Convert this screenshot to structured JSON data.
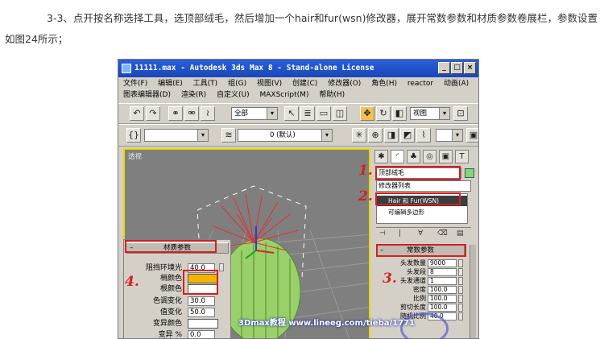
{
  "article": {
    "paragraph": "3-3、点开按名称选择工具，选顶部绒毛，然后增加一个hair和fur(wsn)修改器，展开常数参数和材质参数卷展栏，参数设置如图24所示；"
  },
  "window": {
    "title": "11111.max - Autodesk 3ds Max 8  - Stand-alone License",
    "controls": [
      "_",
      "□",
      "×"
    ]
  },
  "menu": {
    "row1": [
      "文件(F)",
      "编辑(E)",
      "工具(T)",
      "组(G)",
      "视图(V)",
      "创建(C)",
      "修改器(O)",
      "角色(H)",
      "reactor",
      "动画(A)"
    ],
    "row2": [
      "图表编辑器(D)",
      "渲染(R)",
      "自定义(U)",
      "MAXScript(M)",
      "帮助(H)"
    ]
  },
  "toolbar": {
    "selection_filter": "全部",
    "view_combo": "视图",
    "layer_combo": "0 (默认)"
  },
  "viewport": {
    "label": "透视"
  },
  "command_panel": {
    "object_name": "顶部绒毛",
    "modifier_list": "修改器列表",
    "stack": [
      "Hair 和 Fur(WSN)",
      "可编辑多边形"
    ],
    "rollout_title": "常数参数",
    "params": [
      {
        "label": "头发数量",
        "value": "9000"
      },
      {
        "label": "头发段",
        "value": "8"
      },
      {
        "label": "头发通道",
        "value": "1"
      },
      {
        "label": "密度",
        "value": "100.0"
      },
      {
        "label": "比例",
        "value": "100.0"
      },
      {
        "label": "剪切长度",
        "value": "100.0"
      },
      {
        "label": "随机比例",
        "value": "40.0"
      }
    ],
    "obj_color": "#7bd87b"
  },
  "material_panel": {
    "title": "材质参数",
    "rows": [
      {
        "label": "阻挡环境光",
        "value": "40.0",
        "kind": "num"
      },
      {
        "label": "梢颜色",
        "value": "",
        "kind": "color",
        "color": "#f5b400"
      },
      {
        "label": "根颜色",
        "value": "",
        "kind": "color",
        "color": "#ffffff"
      },
      {
        "label": "色调变化",
        "value": "30.0",
        "kind": "num"
      },
      {
        "label": "值变化",
        "value": "50.0",
        "kind": "num"
      },
      {
        "label": "变异颜色",
        "value": "",
        "kind": "color",
        "color": "#ffffff"
      },
      {
        "label": "变异 %",
        "value": "0.0",
        "kind": "num"
      }
    ]
  },
  "annotations": {
    "n1": "1.",
    "n2": "2.",
    "n3": "3.",
    "n4": "4."
  },
  "watermark": "3Dmax教程 www.lineeg.com/tieba/1771"
}
